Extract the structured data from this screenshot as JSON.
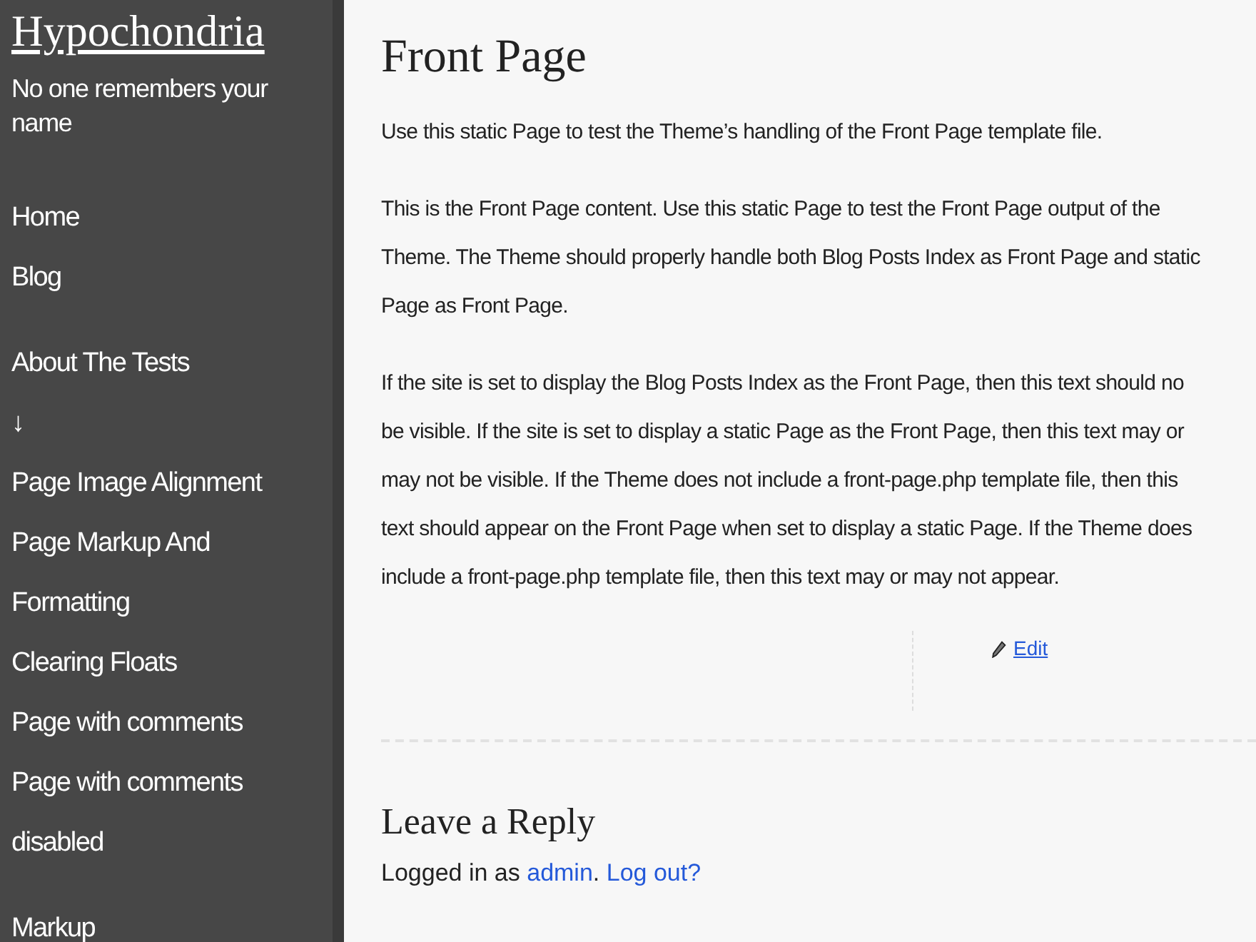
{
  "site": {
    "title": "Hypochondria",
    "tagline": "No one remembers your name"
  },
  "menus": [
    {
      "items": [
        {
          "label": "Home"
        },
        {
          "label": "Blog"
        }
      ]
    },
    {
      "items": [
        {
          "label": "About The Tests"
        },
        {
          "label": "↓"
        },
        {
          "label": "Page Image Alignment"
        },
        {
          "label": "Page Markup And Formatting"
        },
        {
          "label": "Clearing Floats"
        },
        {
          "label": "Page with comments"
        },
        {
          "label": "Page with comments disabled"
        }
      ]
    },
    {
      "items": [
        {
          "label": "Markup"
        }
      ]
    }
  ],
  "post": {
    "title": "Front Page",
    "paragraphs": [
      [
        "Use this static Page to test the Theme’s handling of the Front Page template file."
      ],
      [
        "This is the Front Page content. Use this static Page to test the Front Page output of the",
        "Theme. The Theme should properly handle both Blog Posts Index as Front Page and static",
        "Page as Front Page."
      ],
      [
        "If the site is set to display the Blog Posts Index as the Front Page, then this text should no",
        "be visible. If the site is set to display a static Page as the Front Page, then this text may or",
        "may not be visible. If the Theme does not include a front-page.php template file, then this",
        "text should appear on the Front Page when set to display a static Page. If the Theme does",
        "include a front-page.php template file, then this text may or may not appear."
      ]
    ],
    "edit_link": "Edit"
  },
  "reply": {
    "title": "Leave a Reply",
    "logged_in_prefix": "Logged in as",
    "user": "admin",
    "separator": ".",
    "logout": "Log out?"
  }
}
